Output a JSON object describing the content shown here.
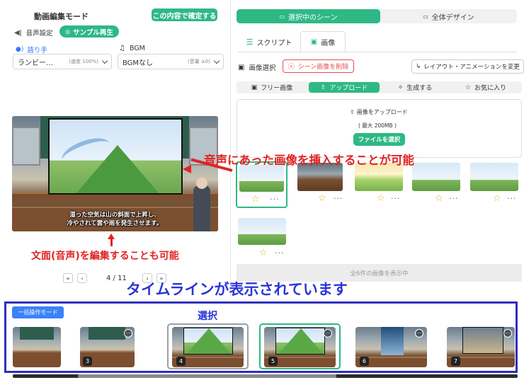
{
  "left": {
    "title": "動画編集モード",
    "confirm_label": "この内容で確定する",
    "audio_settings": "音声設定",
    "sample_play": "サンプル再生",
    "narrator_label": "語り手",
    "bgm_label": "BGM",
    "narrator_value": "ランビー…",
    "narrator_sub": "(速度 100%)",
    "bgm_value": "BGMなし",
    "bgm_sub": "(音量 ±0)",
    "caption_line1": "湿った空気は山の斜面で上昇し、",
    "caption_line2": "冷やされて雲や雨を発生させます。",
    "page_indicator": "4 / 11"
  },
  "right": {
    "tab_current_scene": "選択中のシーン",
    "tab_whole_design": "全体デザイン",
    "subtab_script": "スクリプト",
    "subtab_image": "画像",
    "image_select": "画像選択",
    "delete_scene_image": "シーン画像を削除",
    "layout_animation": "レイアウト・アニメーションを変更",
    "filter_free": "フリー画像",
    "filter_upload": "アップロード",
    "filter_generate": "生成する",
    "filter_favorite": "お気に入り",
    "upload_title": "画像をアップロード",
    "upload_limit": "( 最大 200MB )",
    "choose_file": "ファイルを選択",
    "show_all": "全6件の画像を表示中"
  },
  "annotations": {
    "insert_image": "音声にあった画像を挿入することが可能",
    "edit_text": "文面(音声)を編集することも可能",
    "timeline_shown": "タイムラインが表示されています",
    "select": "選択"
  },
  "timeline": {
    "batch_mode": "一括操作モード",
    "items": [
      {
        "num": ""
      },
      {
        "num": "3"
      },
      {
        "num": "4"
      },
      {
        "num": "5"
      },
      {
        "num": "6"
      },
      {
        "num": "7"
      }
    ]
  },
  "colors": {
    "accent_green": "#2eb886",
    "annotation_red": "#e02424",
    "annotation_blue": "#2a35d6",
    "timeline_frame": "#2f2fbd"
  }
}
